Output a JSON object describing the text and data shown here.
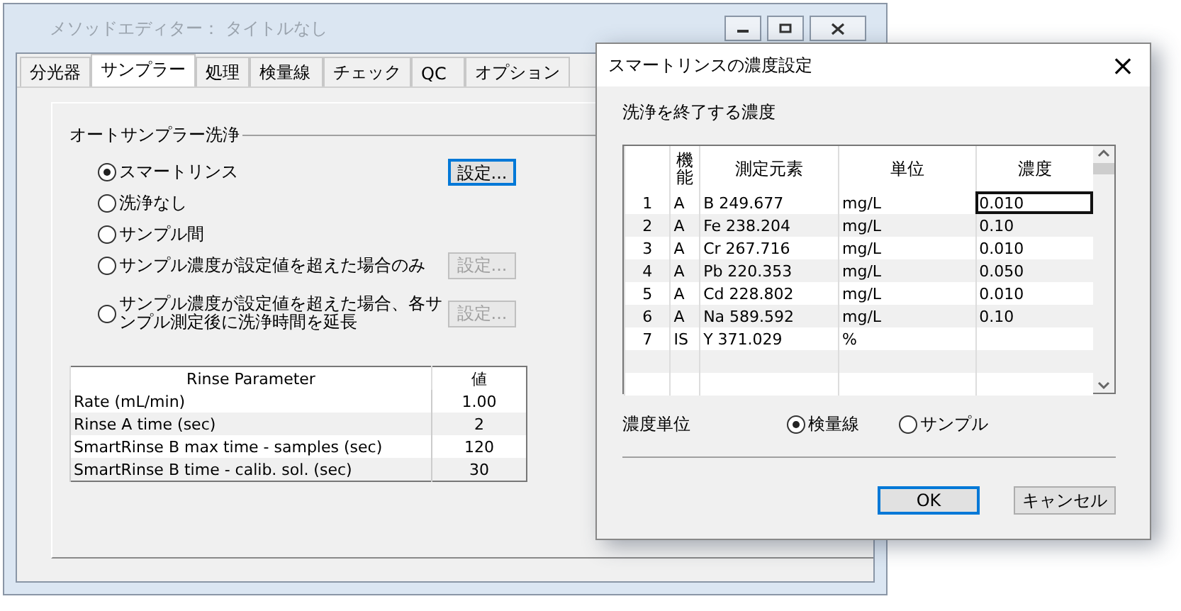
{
  "main_window": {
    "title": "メソッドエディター： タイトルなし",
    "tabs": [
      {
        "label": "分光器",
        "selected": false
      },
      {
        "label": "サンプラー",
        "selected": true
      },
      {
        "label": "処理",
        "selected": false
      },
      {
        "label": "検量線",
        "selected": false
      },
      {
        "label": "チェック",
        "selected": false
      },
      {
        "label": "QC",
        "selected": false
      },
      {
        "label": "オプション",
        "selected": false
      }
    ],
    "group_title": "オートサンプラー洗浄",
    "options": [
      {
        "label": "スマートリンス",
        "selected": true,
        "button": {
          "label": "設定...",
          "disabled": false,
          "focused": true
        }
      },
      {
        "label": "洗浄なし",
        "selected": false
      },
      {
        "label": "サンプル間",
        "selected": false
      },
      {
        "label": "サンプル濃度が設定値を超えた場合のみ",
        "selected": false,
        "button": {
          "label": "設定...",
          "disabled": true,
          "focused": false
        }
      },
      {
        "label": "サンプル濃度が設定値を超えた場合、各サンプル測定後に洗浄時間を延長",
        "selected": false,
        "button": {
          "label": "設定...",
          "disabled": true,
          "focused": false
        }
      }
    ],
    "rinse_table": {
      "columns": [
        "Rinse Parameter",
        "値"
      ],
      "rows": [
        [
          "Rate (mL/min)",
          "1.00"
        ],
        [
          "Rinse A time (sec)",
          "2"
        ],
        [
          "SmartRinse B max time - samples (sec)",
          "120"
        ],
        [
          "SmartRinse B time - calib. sol. (sec)",
          "30"
        ]
      ]
    }
  },
  "dialog": {
    "title": "スマートリンスの濃度設定",
    "close": "×",
    "section_label": "洗浄を終了する濃度",
    "table": {
      "columns": [
        "機能",
        "測定元素",
        "単位",
        "濃度"
      ],
      "rows": [
        {
          "number": "1",
          "function": "A",
          "element": "B 249.677",
          "unit": "mg/L",
          "concentration": "0.010",
          "focused": true
        },
        {
          "number": "2",
          "function": "A",
          "element": "Fe 238.204",
          "unit": "mg/L",
          "concentration": "0.10",
          "focused": false
        },
        {
          "number": "3",
          "function": "A",
          "element": "Cr 267.716",
          "unit": "mg/L",
          "concentration": "0.010",
          "focused": false
        },
        {
          "number": "4",
          "function": "A",
          "element": "Pb 220.353",
          "unit": "mg/L",
          "concentration": "0.050",
          "focused": false
        },
        {
          "number": "5",
          "function": "A",
          "element": "Cd 228.802",
          "unit": "mg/L",
          "concentration": "0.010",
          "focused": false
        },
        {
          "number": "6",
          "function": "A",
          "element": "Na 589.592",
          "unit": "mg/L",
          "concentration": "0.10",
          "focused": false
        },
        {
          "number": "7",
          "function": "IS",
          "element": "Y 371.029",
          "unit": "%",
          "concentration": "",
          "focused": false
        }
      ]
    },
    "unit_label": "濃度単位",
    "unit_options": [
      {
        "label": "検量線",
        "selected": true
      },
      {
        "label": "サンプル",
        "selected": false
      }
    ],
    "buttons": [
      {
        "label": "OK",
        "default": true
      },
      {
        "label": "キャンセル",
        "default": false
      }
    ]
  }
}
